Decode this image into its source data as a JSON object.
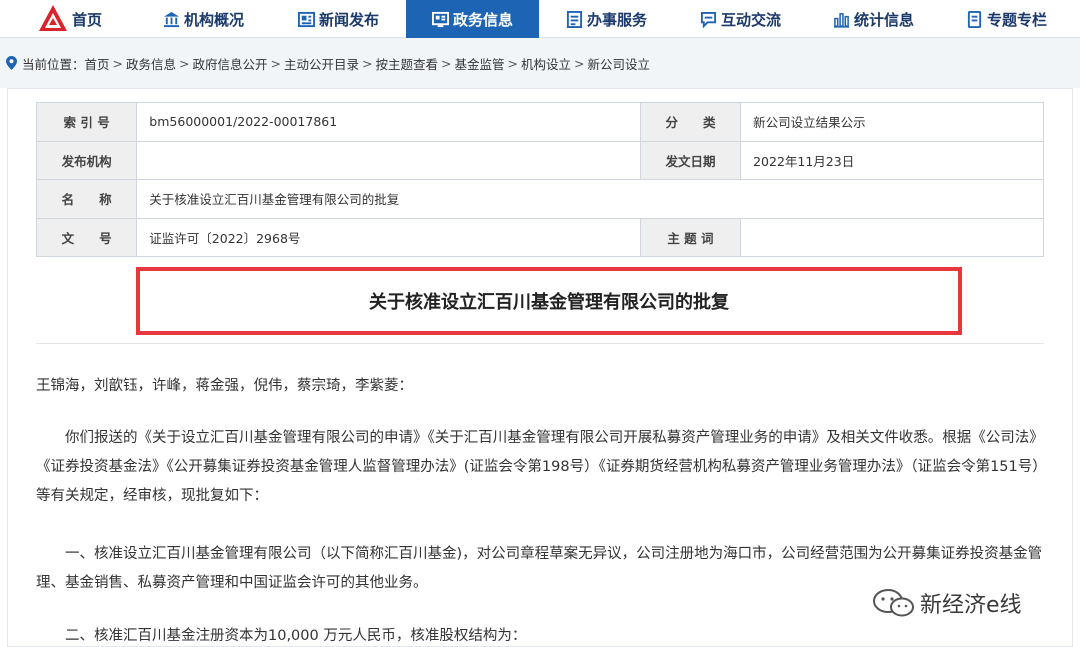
{
  "nav": {
    "items": [
      {
        "label": "首页",
        "icon": "logo-icon"
      },
      {
        "label": "机构概况",
        "icon": "institution-icon"
      },
      {
        "label": "新闻发布",
        "icon": "news-icon"
      },
      {
        "label": "政务信息",
        "icon": "gov-info-icon",
        "active": true
      },
      {
        "label": "办事服务",
        "icon": "service-icon"
      },
      {
        "label": "互动交流",
        "icon": "chat-icon"
      },
      {
        "label": "统计信息",
        "icon": "stats-icon"
      },
      {
        "label": "专题专栏",
        "icon": "topic-icon"
      }
    ],
    "active_color": "#1e64b4"
  },
  "breadcrumb": {
    "prefix": "当前位置：",
    "items": [
      "首页",
      "政务信息",
      "政府信息公开",
      "主动公开目录",
      "按主题查看",
      "基金监管",
      "机构设立",
      "新公司设立"
    ],
    "separator": ">"
  },
  "meta": {
    "index_label": "索 引 号",
    "index_value": "bm56000001/2022-00017861",
    "category_label": "分　　类",
    "category_value": "新公司设立结果公示",
    "issuer_label": "发布机构",
    "issuer_value": "",
    "date_label": "发文日期",
    "date_value": "2022年11月23日",
    "name_label": "名　　称",
    "name_value": "关于核准设立汇百川基金管理有限公司的批复",
    "docno_label": "文　　号",
    "docno_value": "证监许可〔2022〕2968号",
    "subject_label": "主 题 词",
    "subject_value": ""
  },
  "document": {
    "title": "关于核准设立汇百川基金管理有限公司的批复",
    "highlight_color": "#e8383d",
    "greeting": "王锦海，刘歆钰，许峰，蒋金强，倪伟，蔡宗琦，李紫菱：",
    "para1": "你们报送的《关于设立汇百川基金管理有限公司的申请》《关于汇百川基金管理有限公司开展私募资产管理业务的申请》及相关文件收悉。根据《公司法》《证券投资基金法》《公开募集证券投资基金管理人监督管理办法》(证监会令第198号）《证券期货经营机构私募资产管理业务管理办法》（证监会令第151号）等有关规定，经审核，现批复如下：",
    "para2": "一、核准设立汇百川基金管理有限公司（以下简称汇百川基金)，对公司章程草案无异议，公司注册地为海口市，公司经营范围为公开募集证券投资基金管理、基金销售、私募资产管理和中国证监会许可的其他业务。",
    "para3": "二、核准汇百川基金注册资本为10,000 万元人民币，核准股权结构为："
  },
  "watermark": {
    "text": "新经济e线"
  }
}
